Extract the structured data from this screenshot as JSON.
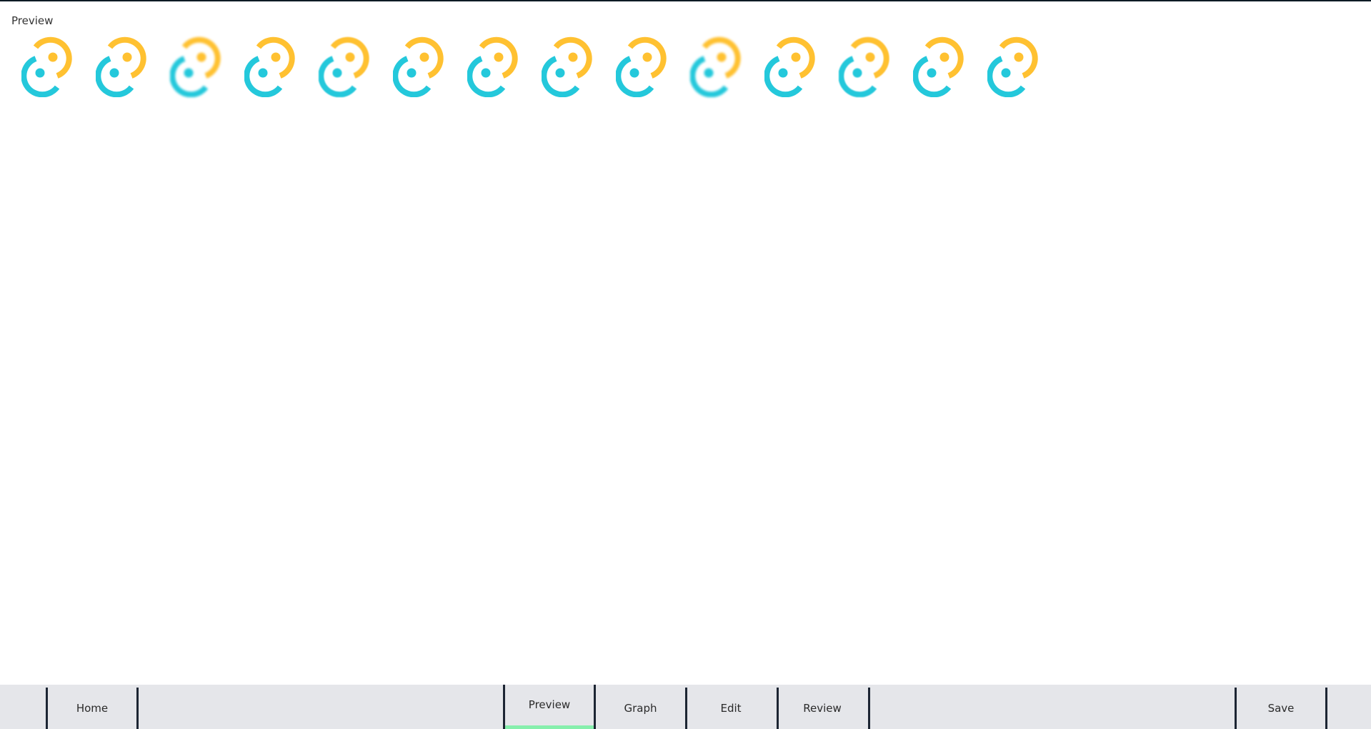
{
  "section": {
    "label": "Preview"
  },
  "icons": [
    {
      "name": "tauri-logo",
      "blur": "none"
    },
    {
      "name": "tauri-logo",
      "blur": "none"
    },
    {
      "name": "tauri-logo",
      "blur": "strong"
    },
    {
      "name": "tauri-logo",
      "blur": "none"
    },
    {
      "name": "tauri-logo",
      "blur": "light"
    },
    {
      "name": "tauri-logo",
      "blur": "none"
    },
    {
      "name": "tauri-logo",
      "blur": "none"
    },
    {
      "name": "tauri-logo",
      "blur": "none"
    },
    {
      "name": "tauri-logo",
      "blur": "none"
    },
    {
      "name": "tauri-logo",
      "blur": "strong"
    },
    {
      "name": "tauri-logo",
      "blur": "none"
    },
    {
      "name": "tauri-logo",
      "blur": "light"
    },
    {
      "name": "tauri-logo",
      "blur": "none"
    },
    {
      "name": "tauri-logo",
      "blur": "none"
    }
  ],
  "colors": {
    "logo_yellow": "#FFC131",
    "logo_cyan": "#24C8DB",
    "active_tab_indicator": "#86EFAC",
    "bar_background": "#E5E6EA",
    "tab_border": "#1C2533"
  },
  "bottom_bar": {
    "tabs": [
      {
        "id": "home",
        "label": "Home",
        "active": false
      },
      {
        "id": "preview",
        "label": "Preview",
        "active": true
      },
      {
        "id": "graph",
        "label": "Graph",
        "active": false
      },
      {
        "id": "edit",
        "label": "Edit",
        "active": false
      },
      {
        "id": "review",
        "label": "Review",
        "active": false
      }
    ],
    "save_label": "Save"
  }
}
